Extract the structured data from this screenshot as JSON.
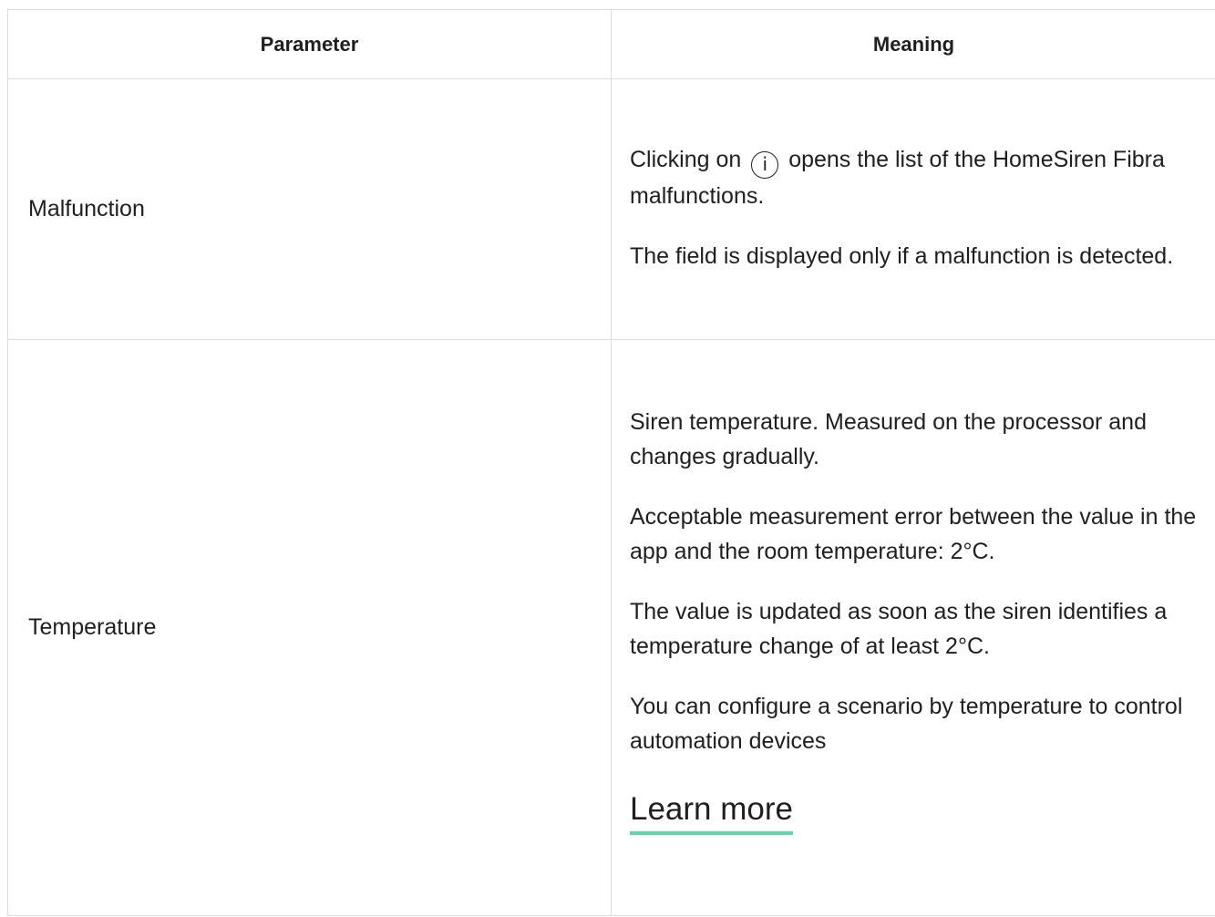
{
  "table": {
    "headers": {
      "parameter": "Parameter",
      "meaning": "Meaning"
    },
    "rows": [
      {
        "parameter": "Malfunction",
        "meaning": {
          "p1_before": "Clicking on",
          "p1_icon": "i",
          "p1_icon_name": "info-icon",
          "p1_after": "opens the list of the HomeSiren Fibra malfunctions.",
          "p2": "The field is displayed only if a malfunction is detected."
        }
      },
      {
        "parameter": "Temperature",
        "meaning": {
          "p1": "Siren temperature. Measured on the processor and changes gradually.",
          "p2": "Acceptable measurement error between the value in the app and the room temperature: 2°C.",
          "p3": "The value is updated as soon as the siren identifies a temperature change of at least 2°C.",
          "p4": "You can configure a scenario by temperature to control automation devices",
          "link": "Learn more",
          "link_underline_color": "#5fd8a8"
        }
      }
    ]
  }
}
